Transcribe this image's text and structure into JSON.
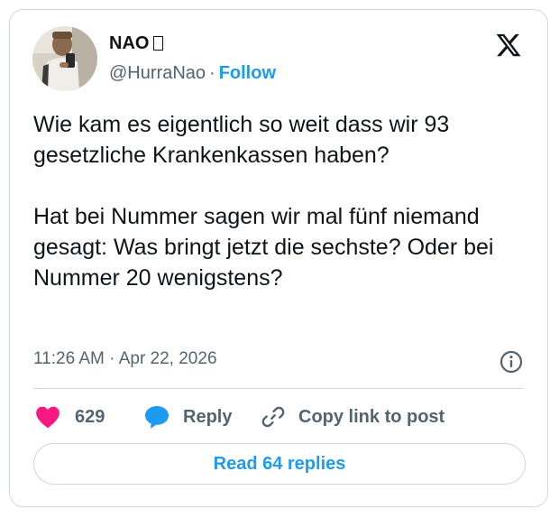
{
  "author": {
    "name": "NAO",
    "handle": "@HurraNao",
    "separator": "·",
    "follow_label": "Follow"
  },
  "tweet": {
    "paragraphs": [
      "Wie kam es eigentlich so weit dass wir 93 gesetzliche Krankenkassen haben?",
      "Hat bei Nummer sagen wir mal fünf niemand gesagt: Was bringt jetzt die sechste? Oder bei Nummer 20 wenigstens?"
    ],
    "timestamp": "11:26 AM · Apr 22, 2026"
  },
  "actions": {
    "like_count": "629",
    "reply_label": "Reply",
    "copy_label": "Copy link to post"
  },
  "read_replies_label": "Read 64 replies",
  "icons": {
    "brand": "x-logo-icon",
    "like": "heart-icon",
    "reply": "speech-bubble-icon",
    "copy": "link-icon",
    "info": "info-icon"
  },
  "colors": {
    "accent": "#1d9bf0",
    "like": "#f91880",
    "text": "#0f1419",
    "muted": "#536471",
    "border": "#cfd9de"
  }
}
